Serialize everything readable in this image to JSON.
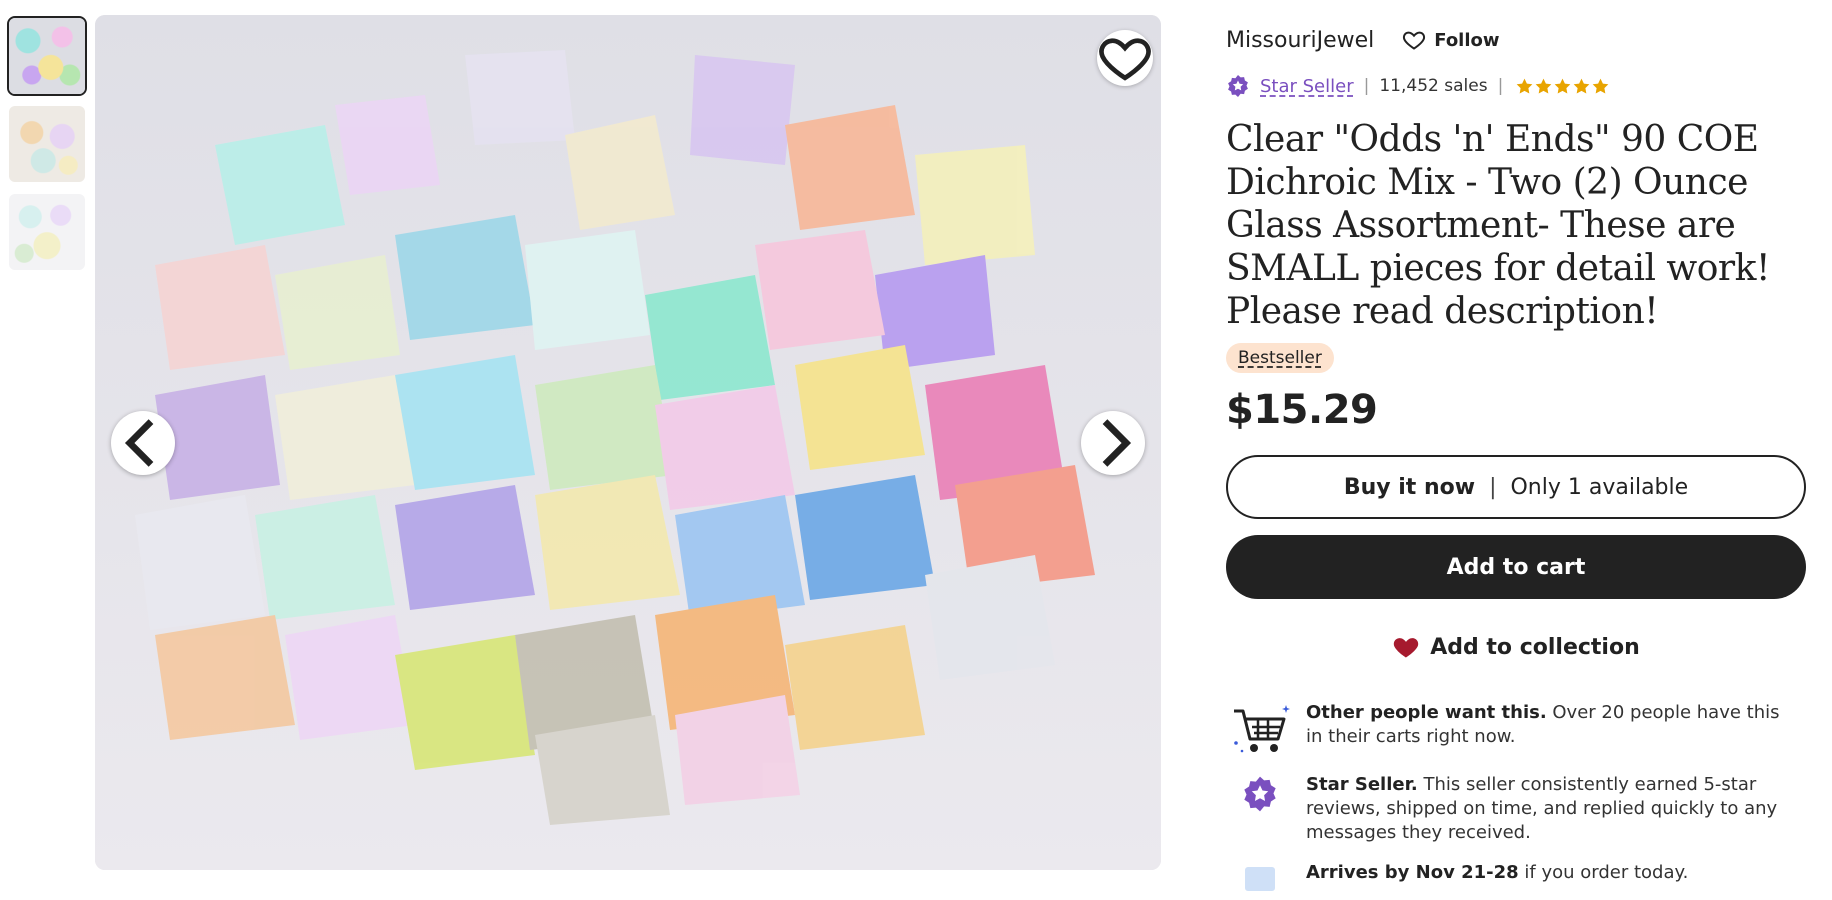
{
  "thumbnails": [
    {
      "alt": "thumbnail-1"
    },
    {
      "alt": "thumbnail-2"
    },
    {
      "alt": "thumbnail-3"
    }
  ],
  "shop": {
    "name": "MissouriJewel",
    "follow_label": "Follow",
    "star_seller_label": "Star Seller",
    "sales": "11,452 sales",
    "rating_stars": 5
  },
  "product": {
    "title": "Clear \"Odds 'n' Ends\" 90 COE Dichroic Mix - Two (2) Ounce Glass Assortment- These are SMALL pieces for detail work! Please read description!",
    "badge": "Bestseller",
    "price": "$15.29"
  },
  "buttons": {
    "buy_now": "Buy it now",
    "buy_sep": "|",
    "availability": "Only 1 available",
    "add_to_cart": "Add to cart",
    "add_to_collection": "Add to collection"
  },
  "perks": [
    {
      "lead": "Other people want this.",
      "text": " Over 20 people have this in their carts right now."
    },
    {
      "lead": "Star Seller.",
      "text": " This seller consistently earned 5-star reviews, shipped on time, and replied quickly to any messages they received."
    },
    {
      "lead": "Arrives by Nov 21-28",
      "text": " if you order today."
    }
  ],
  "colors": {
    "star_seller": "#7a4fbf",
    "stars": "#e8a400",
    "bestseller_bg": "#fde3cf",
    "heart": "#a61a2e",
    "dark_button": "#222222"
  }
}
